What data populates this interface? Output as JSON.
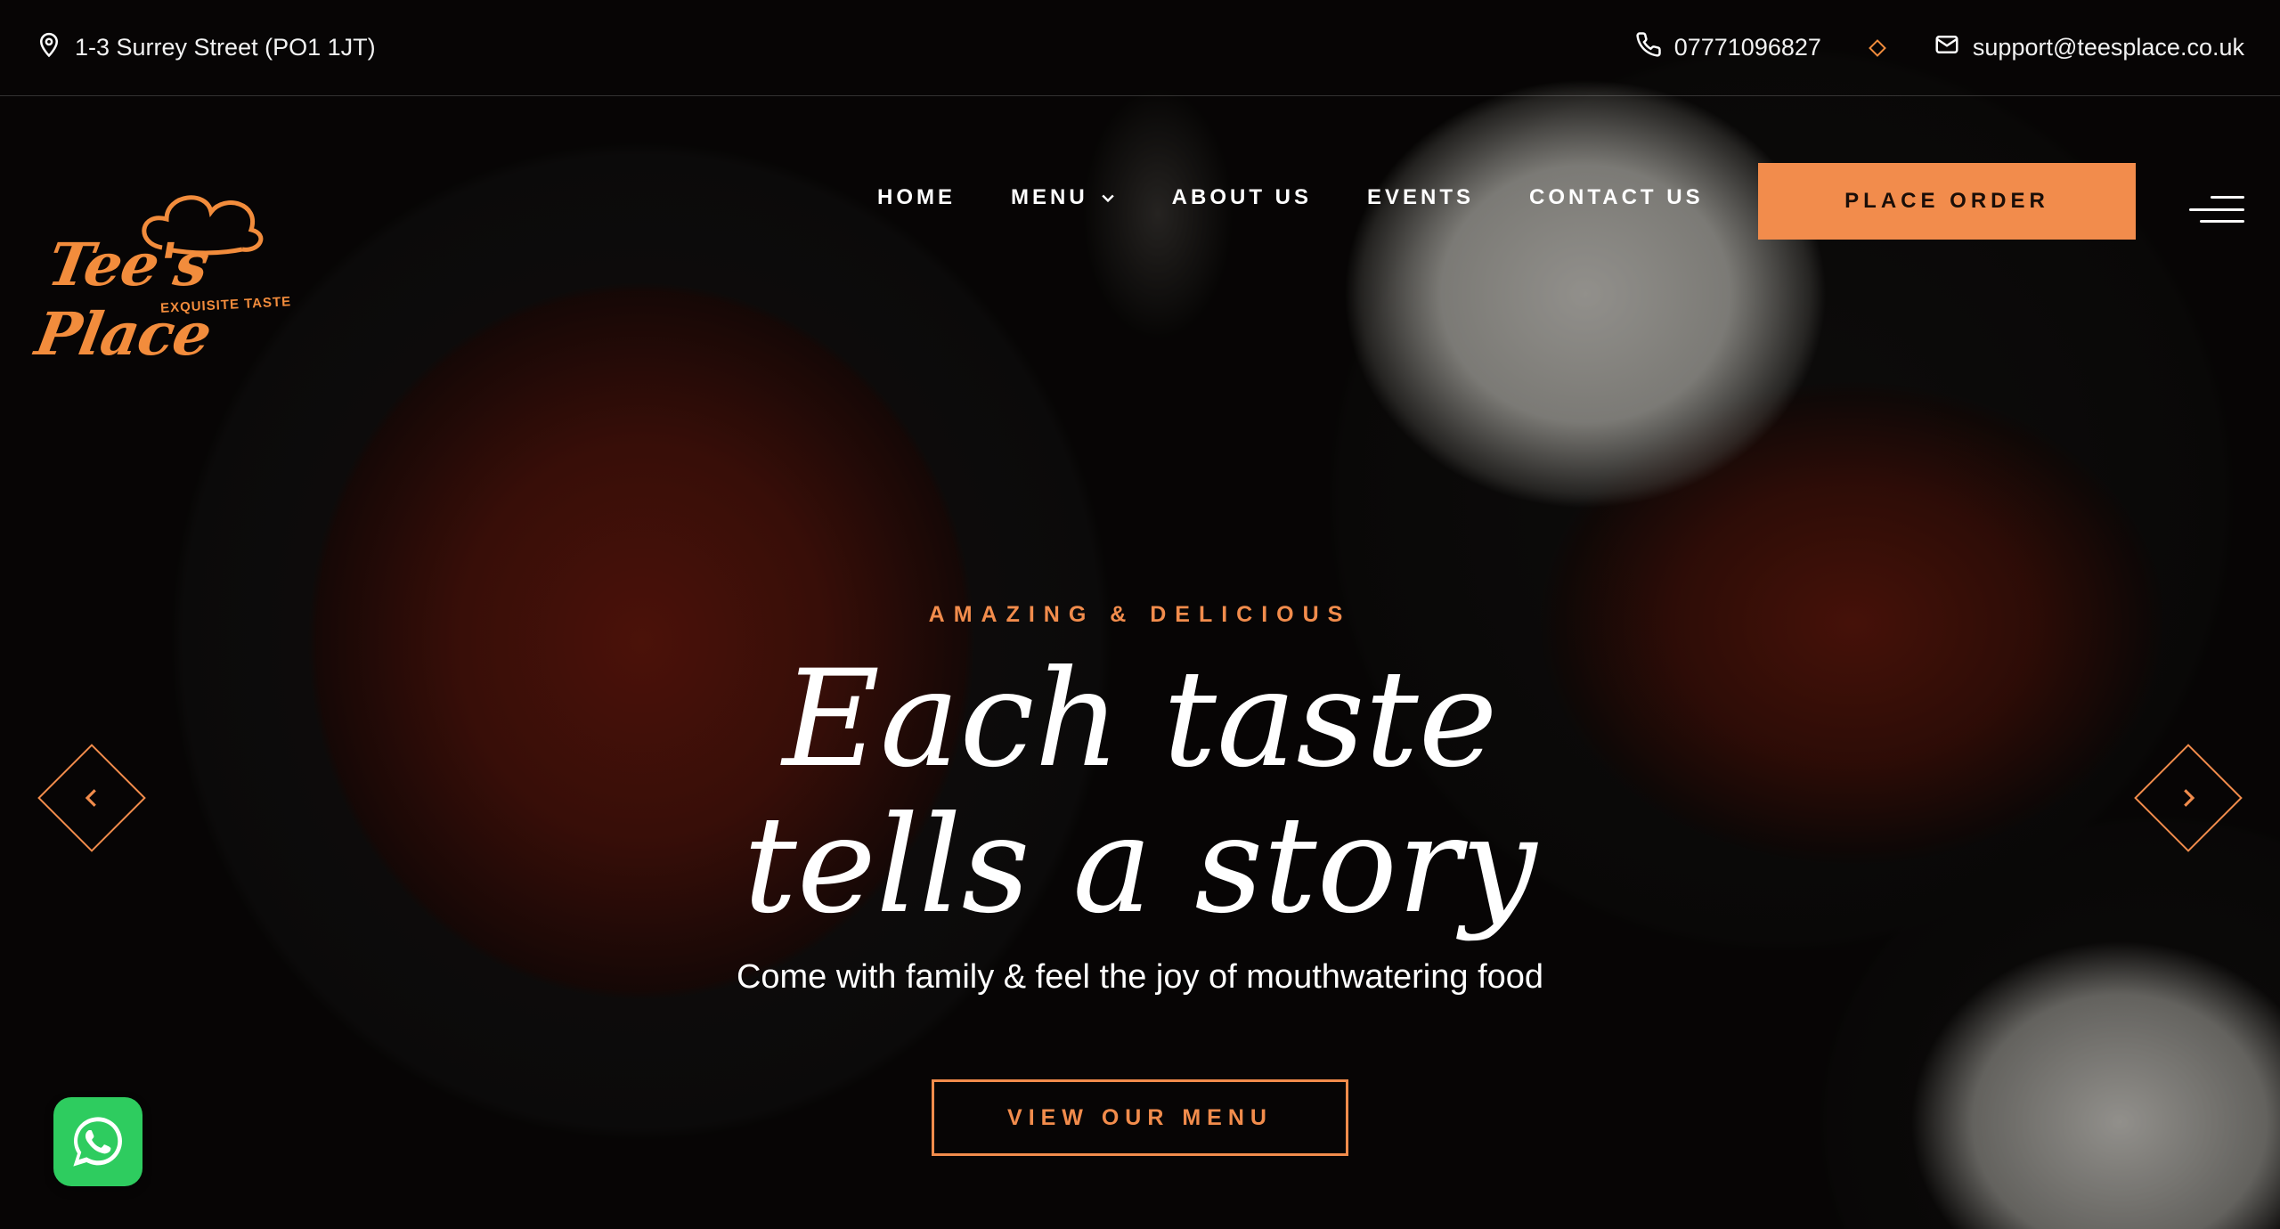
{
  "topbar": {
    "address": "1-3 Surrey Street (PO1 1JT)",
    "phone": "07771096827",
    "email": "support@teesplace.co.uk"
  },
  "logo": {
    "name": "Tee's Place",
    "tagline": "EXQUISITE TASTE"
  },
  "nav": {
    "items": [
      {
        "label": "HOME"
      },
      {
        "label": "MENU"
      },
      {
        "label": "ABOUT US"
      },
      {
        "label": "EVENTS"
      },
      {
        "label": "CONTACT US"
      }
    ],
    "cta": "PLACE ORDER"
  },
  "hero": {
    "kicker": "AMAZING & DELICIOUS",
    "headline_line1": "Each taste",
    "headline_line2": "tells a story",
    "subline": "Come with family & feel the joy of mouthwatering food",
    "button": "VIEW OUR MENU"
  },
  "colors": {
    "accent": "#f28c4c",
    "whatsapp": "#2ecc5f"
  },
  "icons": [
    "location-icon",
    "phone-icon",
    "mail-icon",
    "chevron-down-icon",
    "menu-icon",
    "chevron-left-icon",
    "chevron-right-icon",
    "whatsapp-icon"
  ]
}
